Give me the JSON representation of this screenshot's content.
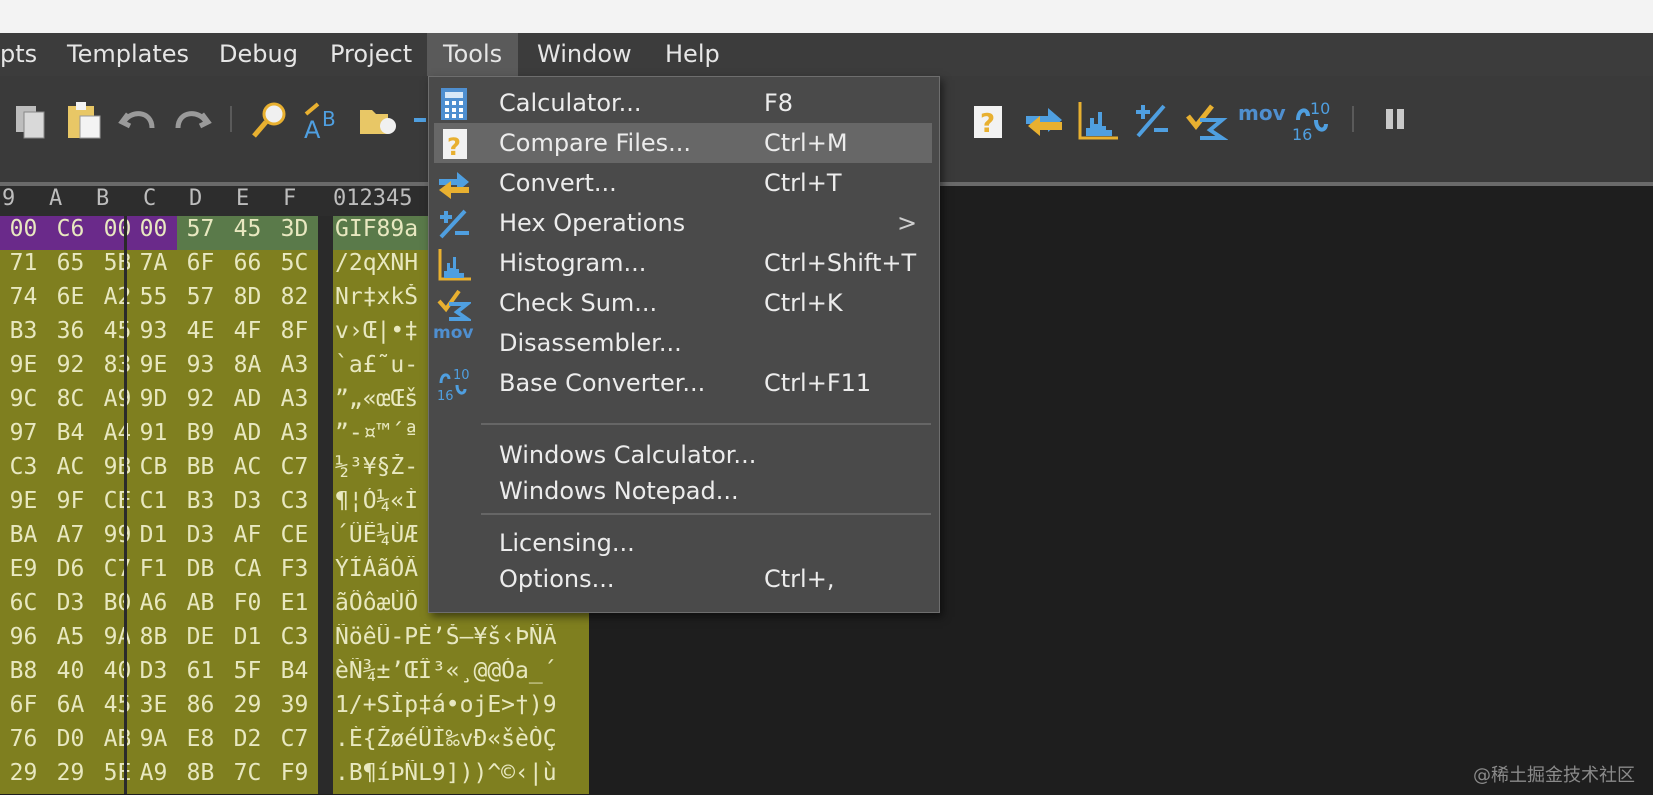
{
  "menubar": {
    "items": [
      "pts",
      "Templates",
      "Debug",
      "Project",
      "Tools",
      "Window",
      "Help"
    ],
    "active": "Tools"
  },
  "toolbar": {
    "icons": [
      "copy-icon",
      "paste-icon",
      "undo-icon",
      "redo-icon",
      "find-icon",
      "replace-icon",
      "open-folder-icon",
      "calculator-icon",
      "compare-icon",
      "convert-icon",
      "histogram-icon",
      "hex-operations-icon",
      "checksum-icon",
      "disassembler-icon",
      "base-converter-icon",
      "pause-icon"
    ],
    "mov_label": "mov"
  },
  "hex": {
    "columns": [
      "9",
      "A",
      "B",
      "C",
      "D",
      "E",
      "F"
    ],
    "ascii_header": "012345",
    "rows": [
      {
        "cells": [
          "00",
          "C6",
          "00",
          "00",
          "57",
          "45",
          "3D"
        ],
        "ascii": "GIF89a"
      },
      {
        "cells": [
          "71",
          "65",
          "5B",
          "7A",
          "6F",
          "66",
          "5C"
        ],
        "ascii": "/2qXNH"
      },
      {
        "cells": [
          "74",
          "6E",
          "A2",
          "55",
          "57",
          "8D",
          "82"
        ],
        "ascii": "Nr‡xkŠ"
      },
      {
        "cells": [
          "B3",
          "36",
          "45",
          "93",
          "4E",
          "4F",
          "8F"
        ],
        "ascii": "v›Œ|•‡"
      },
      {
        "cells": [
          "9E",
          "92",
          "83",
          "9E",
          "93",
          "8A",
          "A3"
        ],
        "ascii": "`a£˜u-"
      },
      {
        "cells": [
          "9C",
          "8C",
          "A9",
          "9D",
          "92",
          "AD",
          "A3"
        ],
        "ascii": "”„«œŒš"
      },
      {
        "cells": [
          "97",
          "B4",
          "A4",
          "91",
          "B9",
          "AD",
          "A3"
        ],
        "ascii": "”-¤™´ª"
      },
      {
        "cells": [
          "C3",
          "AC",
          "9B",
          "CB",
          "BB",
          "AC",
          "C7"
        ],
        "ascii": "½³¥§Ž-"
      },
      {
        "cells": [
          "9E",
          "9F",
          "CE",
          "C1",
          "B3",
          "D3",
          "C3"
        ],
        "ascii": "¶¦Ó¼«Ì"
      },
      {
        "cells": [
          "BA",
          "A7",
          "99",
          "D1",
          "D3",
          "AF",
          "CE"
        ],
        "ascii": "´ÛË¼ÙÆ"
      },
      {
        "cells": [
          "E9",
          "D6",
          "C7",
          "F1",
          "DB",
          "CA",
          "F3"
        ],
        "ascii": "ÝÍÁãÓÄ"
      },
      {
        "cells": [
          "6C",
          "D3",
          "B0",
          "A6",
          "AB",
          "F0",
          "E1"
        ],
        "ascii": "ãÔôæÙÕ"
      },
      {
        "cells": [
          "96",
          "A5",
          "9A",
          "8B",
          "DE",
          "D1",
          "C3"
        ],
        "ascii": "ÑöêÜ-PÈ’Š–¥š‹ÞÑÃ"
      },
      {
        "cells": [
          "B8",
          "40",
          "40",
          "D3",
          "61",
          "5F",
          "B4"
        ],
        "ascii": "èÑ¾±’ŒÎ³«¸@@Óa_´"
      },
      {
        "cells": [
          "6F",
          "6A",
          "45",
          "3E",
          "86",
          "29",
          "39"
        ],
        "ascii": "1/+SÌp‡á•ojE>†)9"
      },
      {
        "cells": [
          "76",
          "D0",
          "AB",
          "9A",
          "E8",
          "D2",
          "C7"
        ],
        "ascii": ".È{ŽøéÛÌ‰vÐ«šèÒÇ"
      },
      {
        "cells": [
          "29",
          "29",
          "5E",
          "A9",
          "8B",
          "7C",
          "F9"
        ],
        "ascii": ".B¶íÞÑL9]))^©‹|ù"
      }
    ]
  },
  "dropdown": {
    "items": [
      {
        "label": "Calculator...",
        "shortcut": "F8",
        "icon": "calculator-icon"
      },
      {
        "label": "Compare Files...",
        "shortcut": "Ctrl+M",
        "icon": "compare-files-icon",
        "highlight": true
      },
      {
        "label": "Convert...",
        "shortcut": "Ctrl+T",
        "icon": "convert-icon"
      },
      {
        "label": "Hex Operations",
        "shortcut": "",
        "icon": "hex-operations-icon",
        "submenu": ">"
      },
      {
        "label": "Histogram...",
        "shortcut": "Ctrl+Shift+T",
        "icon": "histogram-icon"
      },
      {
        "label": "Check Sum...",
        "shortcut": "Ctrl+K",
        "icon": "checksum-icon"
      },
      {
        "label": "Disassembler...",
        "shortcut": "",
        "icon": "disassembler-icon",
        "icon_text": "mov"
      },
      {
        "label": "Base Converter...",
        "shortcut": "Ctrl+F11",
        "icon": "base-converter-icon"
      }
    ],
    "items2": [
      {
        "label": "Windows Calculator..."
      },
      {
        "label": "Windows Notepad..."
      }
    ],
    "items3": [
      {
        "label": "Licensing...",
        "shortcut": ""
      },
      {
        "label": "Options...",
        "shortcut": "Ctrl+,"
      }
    ]
  },
  "watermark": "@稀土掘金技术社区"
}
